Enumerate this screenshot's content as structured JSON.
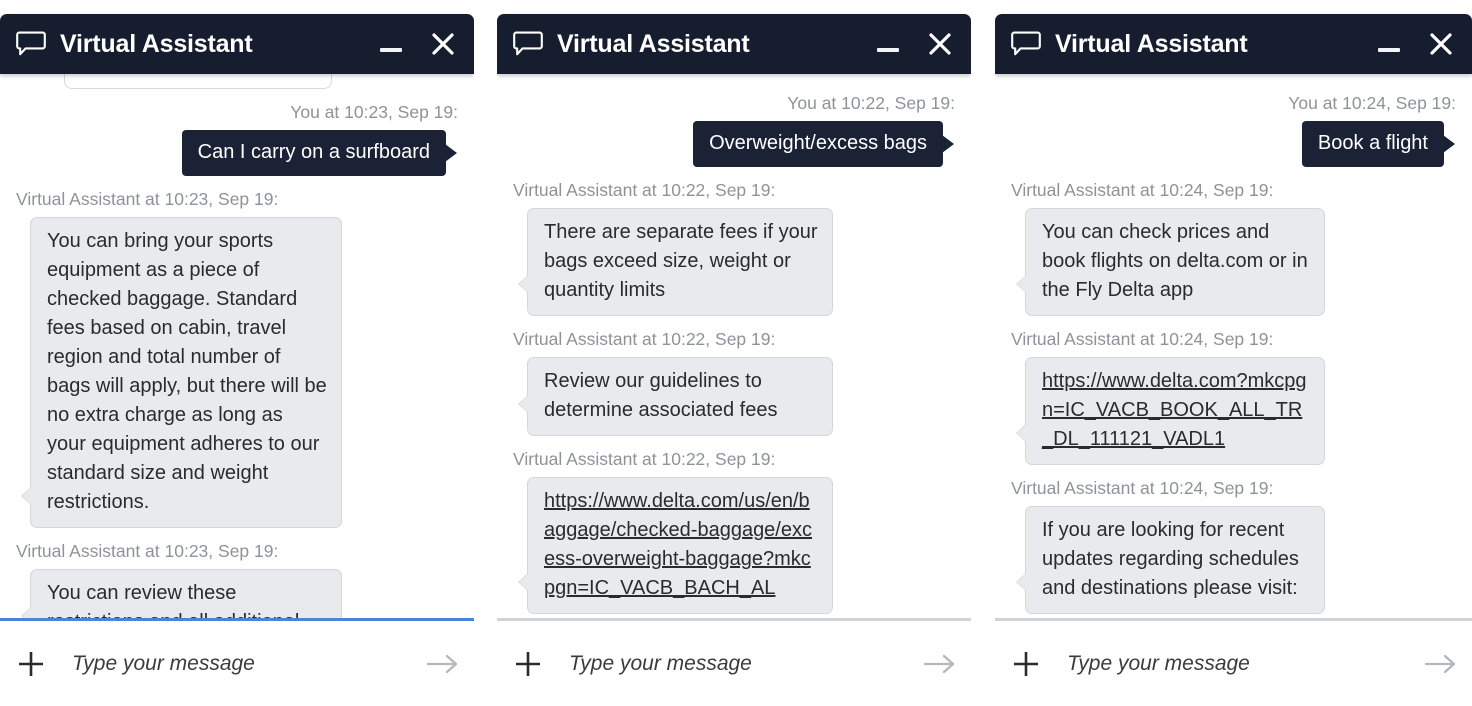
{
  "window": {
    "title": "Virtual Assistant",
    "chat_icon": "speech-bubble-icon",
    "minimize_icon": "minimize-icon",
    "close_icon": "close-icon"
  },
  "composer": {
    "placeholder": "Type your message",
    "attach_icon": "plus-icon",
    "send_icon": "arrow-right-icon"
  },
  "colors": {
    "titlebar_bg": "#161d2f",
    "user_bubble_bg": "#1b2236",
    "bot_bubble_bg": "#e8eaee",
    "meta_text": "#8e9299",
    "focus_accent": "#4a86d8",
    "divider": "#cfd2d6"
  },
  "panels": [
    {
      "id": "panel-surfboard",
      "title": "Virtual Assistant",
      "input_focused": true,
      "has_clipped_top_bubble": true,
      "messages": [
        {
          "sender": "user",
          "meta": "You at 10:23, Sep 19:",
          "text": "Can I carry on a surfboard"
        },
        {
          "sender": "assistant",
          "meta": "Virtual Assistant at 10:23, Sep 19:",
          "text": "You can bring your sports equipment as a piece of checked baggage. Standard fees based on cabin, travel region and total number of bags will apply, but there will be no extra charge as long as your equipment adheres to our standard size and weight restrictions."
        },
        {
          "sender": "assistant",
          "meta": "Virtual Assistant at 10:23, Sep 19:",
          "text": "You can review these restrictions and all additional",
          "clipped": true
        }
      ]
    },
    {
      "id": "panel-overweight",
      "title": "Virtual Assistant",
      "input_focused": false,
      "has_clipped_top_bubble": false,
      "messages": [
        {
          "sender": "user",
          "meta": "You at 10:22, Sep 19:",
          "text": "Overweight/excess bags"
        },
        {
          "sender": "assistant",
          "meta": "Virtual Assistant at 10:22, Sep 19:",
          "text": "There are separate fees if your bags exceed size, weight or quantity limits"
        },
        {
          "sender": "assistant",
          "meta": "Virtual Assistant at 10:22, Sep 19:",
          "text": "Review our guidelines to determine associated fees"
        },
        {
          "sender": "assistant",
          "meta": "Virtual Assistant at 10:22, Sep 19:",
          "text": "https://www.delta.com/us/en/baggage/checked-baggage/excess-overweight-baggage?mkcpgn=IC_VACB_BACH_AL",
          "is_link": true,
          "clipped": true
        }
      ]
    },
    {
      "id": "panel-book-flight",
      "title": "Virtual Assistant",
      "input_focused": false,
      "has_clipped_top_bubble": false,
      "messages": [
        {
          "sender": "user",
          "meta": "You at 10:24, Sep 19:",
          "text": "Book a flight"
        },
        {
          "sender": "assistant",
          "meta": "Virtual Assistant at 10:24, Sep 19:",
          "text": "You can check prices and book flights on delta.com or in the Fly Delta app"
        },
        {
          "sender": "assistant",
          "meta": "Virtual Assistant at 10:24, Sep 19:",
          "text": "https://www.delta.com?mkcpgn=IC_VACB_BOOK_ALL_TR_DL_111121_VADL1",
          "is_link": true
        },
        {
          "sender": "assistant",
          "meta": "Virtual Assistant at 10:24, Sep 19:",
          "text": "If you are looking for recent updates regarding schedules and destinations please visit:"
        }
      ]
    }
  ]
}
